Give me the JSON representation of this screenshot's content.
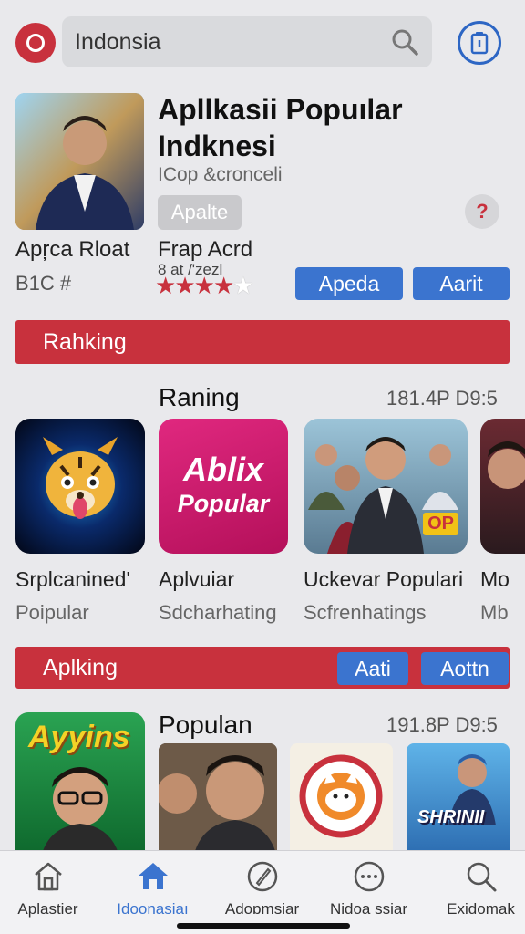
{
  "search": {
    "value": "Indonsia"
  },
  "featured": {
    "title": "Apllkasii Popuılar Indknesi",
    "subtitle": "ICop &cronceli",
    "tag": "Apalte",
    "help": "?",
    "app_name": "Apŗca Rloat",
    "app_code": "B1C #",
    "second_name": "Frap Acrd",
    "meta": "8 at /'zezl",
    "rating": {
      "filled": 4,
      "total": 5
    },
    "buttons": [
      "Apeda",
      "Aarit"
    ]
  },
  "ranking_bar": {
    "label": "Rahking"
  },
  "ranking_section": {
    "heading": "Raning",
    "right": "181.4P D9:5",
    "apps": [
      {
        "name": "Srplcanined'",
        "category": "Poipular",
        "icon": "tiger-mascot-icon"
      },
      {
        "name": "Aplvuiar",
        "category": "Sdcharhating",
        "icon": "ablix-popular-logo",
        "logo_line1": "Ablix",
        "logo_line2": "Popular"
      },
      {
        "name": "Uckevar Populari",
        "category": "Scfrenhatings",
        "icon": "group-photo-icon",
        "badge": "OP"
      },
      {
        "name": "Mo",
        "category": "Mb",
        "icon": "portrait-icon"
      }
    ]
  },
  "apps_bar": {
    "label": "Aplking",
    "buttons": [
      "Aati",
      "Aottn"
    ]
  },
  "popular_section": {
    "heading": "Populan",
    "right": "191.8P D9:5",
    "apps": [
      {
        "icon": "game-poster-icon",
        "title": "Ayyins"
      },
      {
        "icon": "portrait-photo-icon"
      },
      {
        "icon": "cat-badge-icon"
      },
      {
        "icon": "show-poster-icon",
        "title": "SHRINII"
      }
    ]
  },
  "bottom_nav": [
    {
      "label": "Aplastier",
      "icon": "house-outline-icon",
      "active": false
    },
    {
      "label": "Idoonasiaı",
      "icon": "house-filled-icon",
      "active": true
    },
    {
      "label": "Adoɒmsiar",
      "icon": "compass-pen-icon",
      "active": false
    },
    {
      "label": "Nidoa ssiar",
      "icon": "dots-circle-icon",
      "active": false
    },
    {
      "label": "Exidomak",
      "icon": "search-icon",
      "active": false
    }
  ],
  "colors": {
    "accent_red": "#c8313d",
    "accent_blue": "#3b74cf",
    "background": "#e9e9ec"
  }
}
